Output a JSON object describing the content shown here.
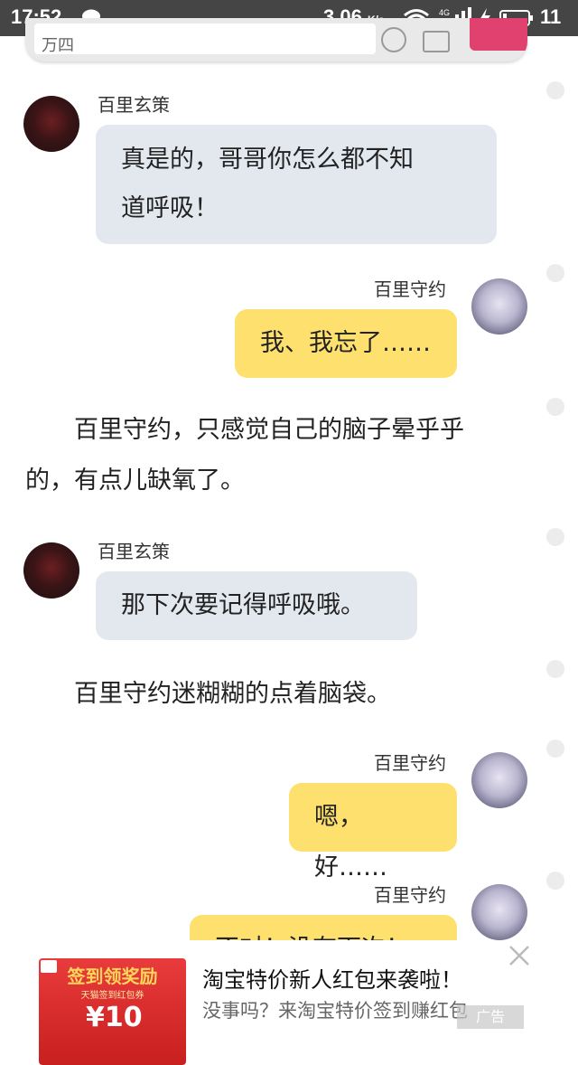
{
  "status_bar": {
    "time": "17:52",
    "net_speed": "3.06",
    "net_unit": "K/s",
    "battery_level": "11",
    "network_type": "4G",
    "icons": [
      "chat-icon",
      "wifi-icon",
      "signal-icon",
      "charging-icon",
      "battery-icon"
    ]
  },
  "top_bar": {
    "search_text": "万四"
  },
  "messages": [
    {
      "type": "chat",
      "side": "left",
      "name": "百里玄策",
      "lines": [
        "真是的，哥哥你怎么都不知",
        "道呼吸！"
      ]
    },
    {
      "type": "chat",
      "side": "right",
      "name": "百里守约",
      "lines": [
        "我、我忘了……"
      ]
    },
    {
      "type": "narration",
      "lines": [
        "　　百里守约，只感觉自己的脑子晕乎乎",
        "的，有点儿缺氧了。"
      ]
    },
    {
      "type": "chat",
      "side": "left",
      "name": "百里玄策",
      "lines": [
        "那下次要记得呼吸哦。"
      ]
    },
    {
      "type": "narration",
      "lines": [
        "　　百里守约迷糊糊的点着脑袋。"
      ]
    },
    {
      "type": "chat",
      "side": "right",
      "name": "百里守约",
      "lines": [
        "嗯，好……"
      ]
    },
    {
      "type": "chat",
      "side": "right",
      "name": "百里守约",
      "lines": [
        "不对！没有下次！"
      ]
    }
  ],
  "ad": {
    "image_title": "签到领奖励",
    "image_subtitle": "天猫签到红包券",
    "image_amount": "¥10",
    "title": "淘宝特价新人红包来袭啦！",
    "description": "没事吗？来淘宝特价签到赚红包",
    "label": "广告"
  },
  "colors": {
    "status_bar_bg": "#454545",
    "left_bubble": "#e3e8ef",
    "right_bubble": "#fde06d",
    "ad_red": "#e93b3b"
  }
}
